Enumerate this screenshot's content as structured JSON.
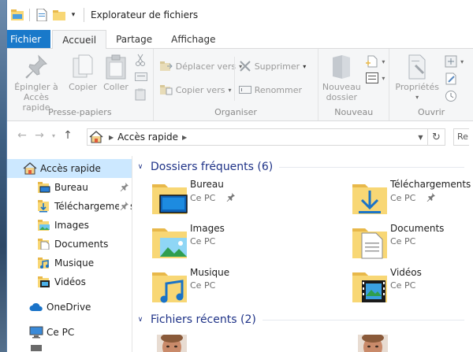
{
  "window": {
    "title": "Explorateur de fichiers"
  },
  "tabs": [
    {
      "label": "Fichier"
    },
    {
      "label": "Accueil"
    },
    {
      "label": "Partage"
    },
    {
      "label": "Affichage"
    }
  ],
  "ribbon": {
    "pin_label_1": "Épingler à",
    "pin_label_2": "Accès rapide",
    "copy_label": "Copier",
    "paste_label": "Coller",
    "group_clipboard": "Presse-papiers",
    "move_to": "Déplacer vers",
    "copy_to": "Copier vers",
    "delete": "Supprimer",
    "rename": "Renommer",
    "group_organize": "Organiser",
    "new_folder_1": "Nouveau",
    "new_folder_2": "dossier",
    "group_new": "Nouveau",
    "properties": "Propriétés",
    "group_open": "Ouvrir"
  },
  "address": {
    "path": "Accès rapide"
  },
  "search": {
    "stub": "Re"
  },
  "navpane": {
    "quick_access": "Accès rapide",
    "items": [
      {
        "label": "Bureau"
      },
      {
        "label": "Téléchargements"
      },
      {
        "label": "Images"
      },
      {
        "label": "Documents"
      },
      {
        "label": "Musique"
      },
      {
        "label": "Vidéos"
      }
    ],
    "onedrive": "OneDrive",
    "this_pc": "Ce PC"
  },
  "content": {
    "frequent_title": "Dossiers fréquents (6)",
    "recent_title": "Fichiers récents (2)",
    "folders": [
      {
        "name": "Bureau",
        "location": "Ce PC"
      },
      {
        "name": "Téléchargements",
        "location": "Ce PC"
      },
      {
        "name": "Images",
        "location": "Ce PC"
      },
      {
        "name": "Documents",
        "location": "Ce PC"
      },
      {
        "name": "Musique",
        "location": "Ce PC"
      },
      {
        "name": "Vidéos",
        "location": "Ce PC"
      }
    ]
  },
  "colors": {
    "file_tab": "#1979ca",
    "section_title": "#1e3287",
    "selection": "#cce8ff",
    "folder_yellow": "#f8d775"
  }
}
